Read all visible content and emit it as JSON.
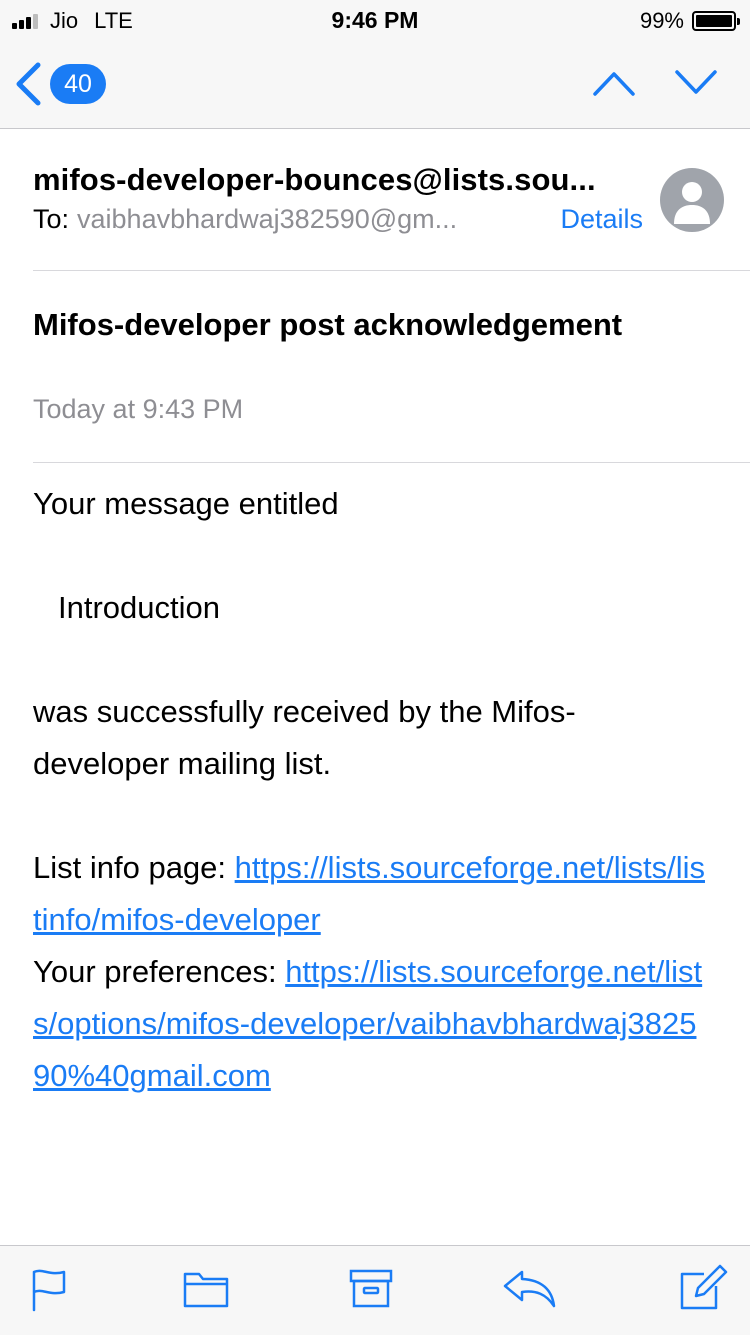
{
  "status_bar": {
    "carrier": "Jio",
    "network": "LTE",
    "time": "9:46 PM",
    "battery": "99%",
    "battery_level": 0.99
  },
  "nav": {
    "back_count": "40",
    "icons": [
      "chevron-left-icon",
      "chevron-up-icon",
      "chevron-down-icon"
    ]
  },
  "header": {
    "from": "mifos-developer-bounces@lists.sou...",
    "to_label": "To:",
    "to_value": "vaibhavbhardwaj382590@gm...",
    "details_label": "Details"
  },
  "message": {
    "subject": "Mifos-developer post acknowledgement",
    "date": "Today at 9:43 PM",
    "line1": "Your message entitled",
    "entitled": "Introduction",
    "line2": "was successfully received by the Mifos-developer mailing list.",
    "list_info_label": "List info page: ",
    "list_info_url": "https://lists.sourceforge.net/lists/listinfo/mifos-developer",
    "prefs_label": "Your preferences: ",
    "prefs_url": "https://lists.sourceforge.net/lists/options/mifos-developer/vaibhavbhardwaj382590%40gmail.com"
  },
  "toolbar": {
    "icons": [
      "flag-icon",
      "folder-icon",
      "archive-icon",
      "reply-icon",
      "compose-icon"
    ]
  },
  "colors": {
    "accent": "#1a7cf5",
    "secondary_text": "#8e8e93",
    "bar_background": "#f7f7f7"
  }
}
